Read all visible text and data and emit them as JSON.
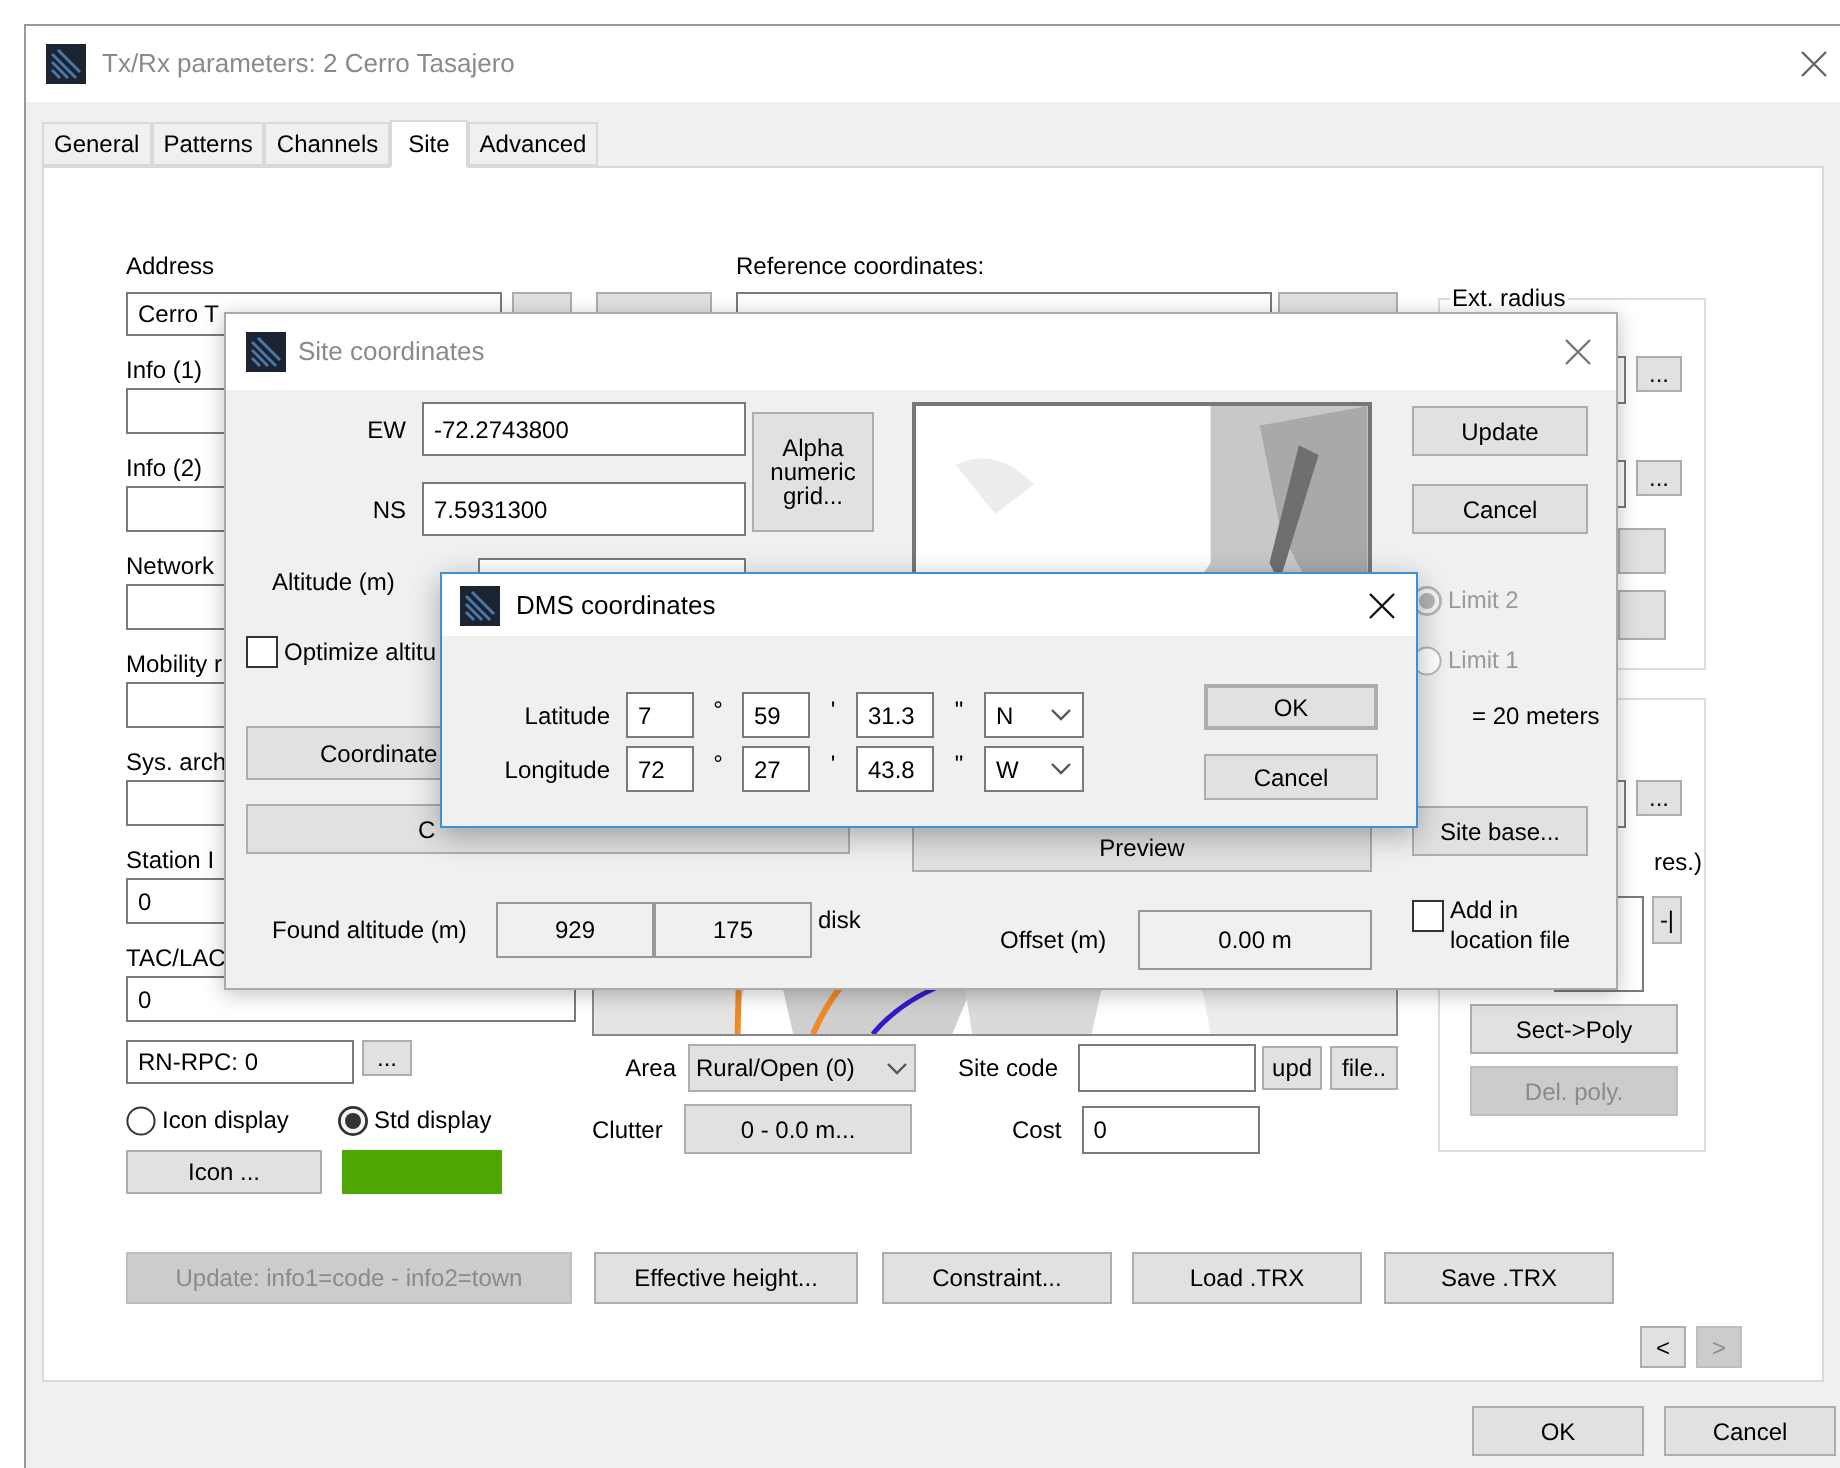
{
  "main_window": {
    "title": "Tx/Rx parameters: 2 Cerro Tasajero",
    "tabs": [
      {
        "label": "General",
        "selected": false
      },
      {
        "label": "Patterns",
        "selected": false
      },
      {
        "label": "Channels",
        "selected": false
      },
      {
        "label": "Site",
        "selected": true
      },
      {
        "label": "Advanced",
        "selected": false
      }
    ],
    "address": {
      "label": "Address",
      "value": "Cerro T"
    },
    "reference_coordinates": {
      "label": "Reference coordinates:"
    },
    "left_fields": [
      {
        "label": "Info (1)"
      },
      {
        "label": "Info (2)"
      },
      {
        "label": "Network"
      },
      {
        "label": "Mobility r"
      },
      {
        "label": "Sys. arch"
      },
      {
        "label": "Station I",
        "value": "0"
      },
      {
        "label": "TAC/LAC",
        "value": "0"
      }
    ],
    "rn_rpc": {
      "value": "RN-RPC: 0",
      "button": "..."
    },
    "display_options": [
      {
        "label": "Icon display",
        "selected": false
      },
      {
        "label": "Std display",
        "selected": true
      }
    ],
    "icon_button": "Icon ...",
    "display_color": {
      "color": "#4ea600"
    },
    "area": {
      "label": "Area",
      "value": "Rural/Open (0)"
    },
    "clutter": {
      "label": "Clutter",
      "button": "0 - 0.0 m..."
    },
    "site_code": {
      "label": "Site code",
      "buttons": [
        "upd",
        "file.."
      ]
    },
    "cost": {
      "label": "Cost",
      "value": "0"
    },
    "ext_radius": {
      "legend": "Ext. radius",
      "buttons": [
        "...",
        "..."
      ]
    },
    "polygon_group": {
      "button": "...",
      "text": "res.)",
      "side_button": "-|",
      "actions": [
        {
          "label": "Sect->Poly",
          "disabled": false
        },
        {
          "label": "Del. poly.",
          "disabled": true
        }
      ]
    },
    "bottom_buttons": [
      {
        "label": "Update: info1=code - info2=town",
        "disabled": true
      },
      {
        "label": "Effective height...",
        "disabled": false
      },
      {
        "label": "Constraint...",
        "disabled": false
      },
      {
        "label": "Load .TRX",
        "disabled": false
      },
      {
        "label": "Save .TRX",
        "disabled": false
      }
    ],
    "nav_buttons": [
      {
        "label": "<",
        "disabled": false
      },
      {
        "label": ">",
        "disabled": true
      }
    ],
    "footer_buttons": [
      "OK",
      "Cancel"
    ]
  },
  "site_dialog": {
    "title": "Site coordinates",
    "ew": {
      "label": "EW",
      "value": "-72.2743800"
    },
    "ns": {
      "label": "NS",
      "value": "7.5931300"
    },
    "grid_button": "Alpha numeric grid...",
    "altitude": {
      "label": "Altitude (m)"
    },
    "optimize": {
      "label": "Optimize altitu",
      "checked": false
    },
    "coordinate_button": "Coordinate",
    "c_button": "C",
    "update_button": "Update",
    "cancel_button": "Cancel",
    "limits": [
      {
        "label": "Limit 2",
        "selected": true,
        "disabled": true
      },
      {
        "label": "Limit 1",
        "selected": false,
        "disabled": true
      }
    ],
    "precision": "= 20 meters",
    "preview_button": "Preview",
    "site_base_button": "Site base...",
    "found_altitude": {
      "label": "Found altitude (m)",
      "values": [
        "929",
        "175"
      ],
      "source": "disk"
    },
    "offset": {
      "label": "Offset (m)",
      "value": "0.00 m"
    },
    "add_location": {
      "label": "Add in location file",
      "checked": false
    }
  },
  "dms_dialog": {
    "title": "DMS coordinates",
    "rows": [
      {
        "label": "Latitude",
        "degrees": "7",
        "degree_sign": "°",
        "minutes": "59",
        "minute_sign": "'",
        "seconds": "31.3",
        "second_sign": "\"",
        "hemisphere": "N"
      },
      {
        "label": "Longitude",
        "degrees": "72",
        "degree_sign": "°",
        "minutes": "27",
        "minute_sign": "'",
        "seconds": "43.8",
        "second_sign": "\"",
        "hemisphere": "W"
      }
    ],
    "ok_button": "OK",
    "cancel_button": "Cancel"
  }
}
